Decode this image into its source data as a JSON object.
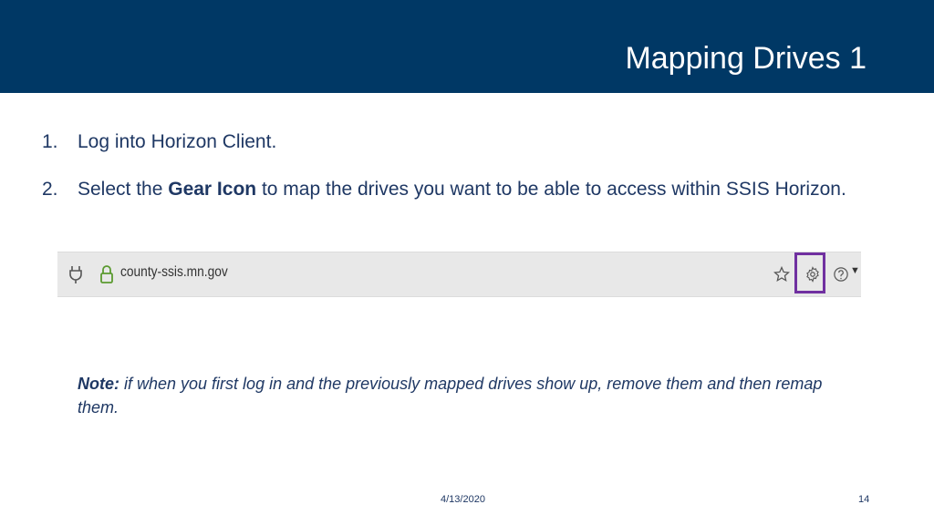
{
  "slide": {
    "title": "Mapping Drives 1",
    "date": "4/13/2020",
    "page_number": "14"
  },
  "steps": [
    {
      "number": "1.",
      "text": "Log into Horizon Client."
    },
    {
      "number": "2.",
      "text_before": "Select the ",
      "bold": "Gear Icon",
      "text_after": " to map the drives you want to be able to access within SSIS Horizon."
    }
  ],
  "browser_bar": {
    "url": "county-ssis.mn.gov",
    "icons": [
      "plug-icon",
      "lock-icon",
      "star-icon",
      "gear-icon",
      "help-icon",
      "caret-down-icon"
    ],
    "highlight_color": "#7030a0"
  },
  "note": {
    "label": "Note:",
    "text": " if when you first log in and the previously mapped drives show up, remove them and then remap them."
  },
  "colors": {
    "header_bg": "#003865",
    "text": "#1f3864"
  }
}
